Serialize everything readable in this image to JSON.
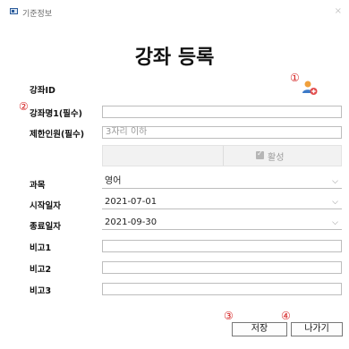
{
  "window": {
    "title": "기준정보",
    "close_glyph": "×"
  },
  "page_title": "강좌 등록",
  "icons": {
    "add_user": "user-add-icon",
    "app": "app-icon"
  },
  "annotations": [
    "①",
    "②",
    "③",
    "④"
  ],
  "form": {
    "course_id": {
      "label": "강좌ID"
    },
    "course_name": {
      "label": "강좌명1(필수)",
      "value": ""
    },
    "capacity": {
      "label": "제한인원(필수)",
      "placeholder": "3자리 이하"
    },
    "active": {
      "label": "활성",
      "checked": true
    },
    "subject": {
      "label": "과목",
      "value": "영어"
    },
    "start_date": {
      "label": "시작일자",
      "value": "2021-07-01"
    },
    "end_date": {
      "label": "종료일자",
      "value": "2021-09-30"
    },
    "note1": {
      "label": "비고1",
      "value": ""
    },
    "note2": {
      "label": "비고2",
      "value": ""
    },
    "note3": {
      "label": "비고3",
      "value": ""
    }
  },
  "buttons": {
    "save": "저장",
    "exit": "나가기"
  },
  "colors": {
    "annotation": "#d42020",
    "border": "#bdbdbd",
    "icon_orange": "#f0a03c",
    "icon_blue": "#3c7ac8"
  }
}
